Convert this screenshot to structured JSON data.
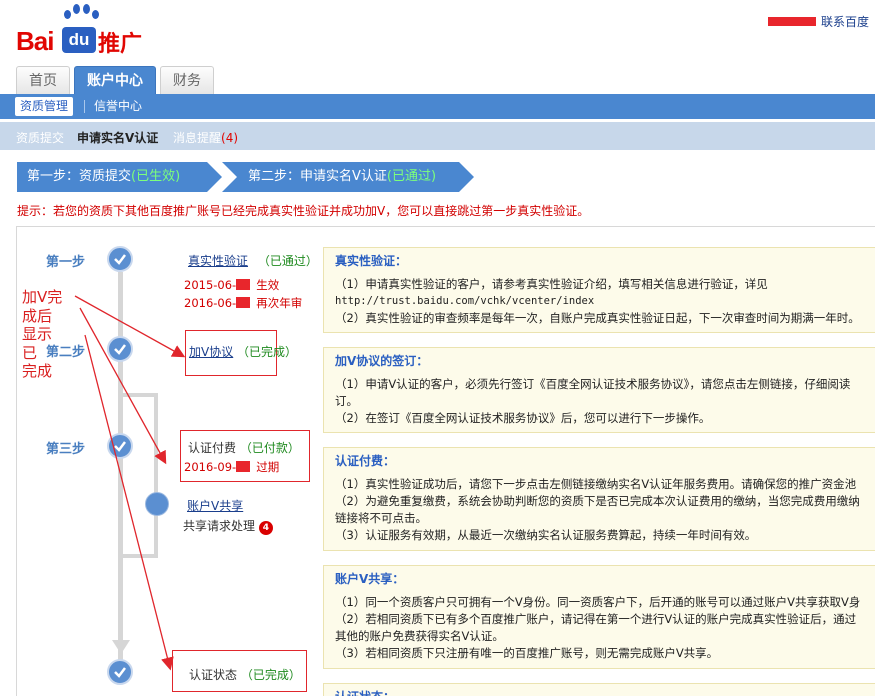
{
  "header": {
    "logo": {
      "bai": "Bai",
      "du": "du",
      "suffix": "推广"
    },
    "contact_link": "联系百度"
  },
  "tabs": [
    {
      "label": "首页",
      "active": false
    },
    {
      "label": "账户中心",
      "active": true
    },
    {
      "label": "财务",
      "active": false
    }
  ],
  "subnav": [
    {
      "label": "资质管理",
      "active": true
    },
    {
      "label": "信誉中心",
      "active": false
    }
  ],
  "secondary_nav": {
    "item1": "资质提交",
    "item2": "申请实名V认证",
    "item3": "消息提醒",
    "item3_count": "(4)"
  },
  "progress": {
    "step1": {
      "label": "第一步：资质提交",
      "status": "(已生效)"
    },
    "step2": {
      "label": "第二步：申请实名V认证",
      "status": "(已通过)"
    }
  },
  "tip": "提示：若您的资质下其他百度推广账号已经完成真实性验证并成功加V，您可以直接跳过第一步真实性验证。",
  "timeline": {
    "step1_label": "第一步",
    "step2_label": "第二步",
    "step3_label": "第三步",
    "authenticity": {
      "link": "真实性验证",
      "status": "（已通过）",
      "date1": "2015-06-",
      "date1_note": "生效",
      "date2": "2016-06-",
      "date2_note": "再次年审"
    },
    "agreement": {
      "link": "加V协议",
      "status": "（已完成）"
    },
    "payment": {
      "label": "认证付费",
      "status": "（已付款）",
      "date": "2016-09-",
      "date_note": "过期"
    },
    "share": {
      "link": "账户V共享",
      "request_label": "共享请求处理",
      "request_count": "4"
    },
    "final": {
      "label": "认证状态",
      "status": "（已完成）"
    }
  },
  "annotation": [
    "加V完",
    "成后",
    "显示",
    "已",
    "完成"
  ],
  "panels": [
    {
      "title": "真实性验证：",
      "lines": [
        "（1）申请真实性验证的客户，请参考真实性验证介绍，填写相关信息进行验证，详见",
        "http://trust.baidu.com/vchk/vcenter/index",
        "（2）真实性验证的审查频率是每年一次，自账户完成真实性验证日起，下一次审查时间为期满一年时。"
      ]
    },
    {
      "title": "加V协议的签订：",
      "lines": [
        "（1）申请V认证的客户，必须先行签订《百度全网认证技术服务协议》，请您点击左侧链接，仔细阅读",
        "订。",
        "（2）在签订《百度全网认证技术服务协议》后，您可以进行下一步操作。"
      ]
    },
    {
      "title": "认证付费：",
      "lines": [
        "（1）真实性验证成功后，请您下一步点击左侧链接缴纳实名V认证年服务费用。请确保您的推广资金池",
        "（2）为避免重复缴费，系统会协助判断您的资质下是否已完成本次认证费用的缴纳，当您完成费用缴纳",
        "链接将不可点击。",
        "（3）认证服务有效期，从最近一次缴纳实名认证服务费算起，持续一年时间有效。"
      ]
    },
    {
      "title": "账户V共享：",
      "lines": [
        "（1）同一个资质客户只可拥有一个V身份。同一资质客户下，后开通的账号可以通过账户V共享获取V身",
        "（2）若相同资质下已有多个百度推广账户，请记得在第一个进行V认证的账户完成真实性验证后，通过",
        "其他的账户免费获得实名V认证。",
        "（3）若相同资质下只注册有唯一的百度推广账号，则无需完成账户V共享。"
      ]
    },
    {
      "title": "认证状态："
    }
  ]
}
